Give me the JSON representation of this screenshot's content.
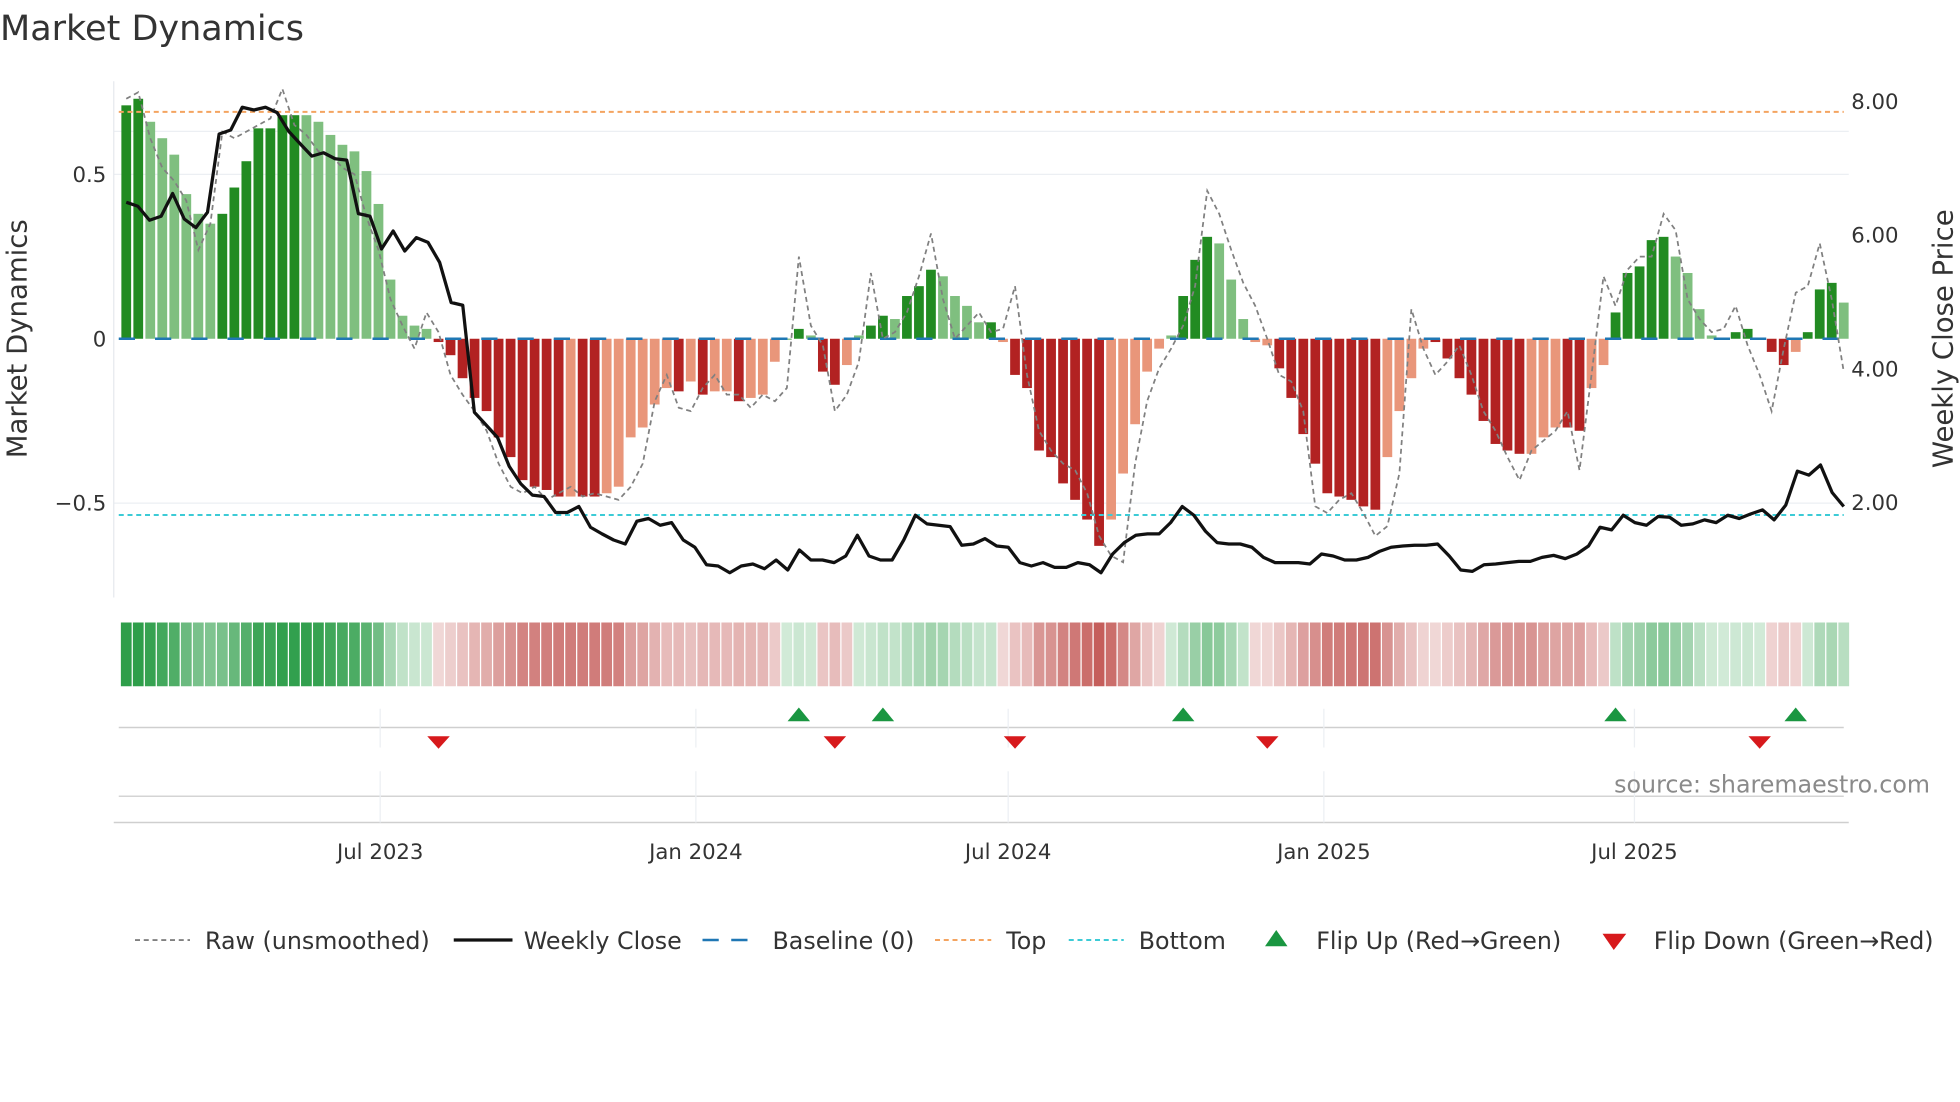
{
  "chart_data": {
    "type": "bar",
    "title": "Market Dynamics",
    "ylabel": "Market Dynamics",
    "ylabel_right": "Weekly Close Price",
    "ylim": [
      -0.78,
      0.78
    ],
    "ylim_right": [
      0.5,
      8.5
    ],
    "yticks": [
      {
        "value": 0.5,
        "label": "0.5"
      },
      {
        "value": 0,
        "label": "0"
      },
      {
        "value": -0.5,
        "label": "−0.5"
      }
    ],
    "yticks_right": [
      {
        "value": 8,
        "label": "8.00"
      },
      {
        "value": 6,
        "label": "6.00"
      },
      {
        "value": 4,
        "label": "4.00"
      },
      {
        "value": 2,
        "label": "2.00"
      }
    ],
    "xticks": [
      {
        "date": "2023-07-01",
        "label": "Jul 2023"
      },
      {
        "date": "2024-01-01",
        "label": "Jan 2024"
      },
      {
        "date": "2024-07-01",
        "label": "Jul 2024"
      },
      {
        "date": "2025-01-01",
        "label": "Jan 2025"
      },
      {
        "date": "2025-07-01",
        "label": "Jul 2025"
      }
    ],
    "x_start": "2023-02-03",
    "frequency": "weekly",
    "top_level": 0.69,
    "bottom_level": -0.536,
    "baseline": 0,
    "values": [
      0.71,
      0.73,
      0.66,
      0.61,
      0.56,
      0.44,
      0.38,
      0.35,
      0.38,
      0.46,
      0.54,
      0.64,
      0.64,
      0.68,
      0.68,
      0.68,
      0.66,
      0.62,
      0.59,
      0.57,
      0.51,
      0.41,
      0.18,
      0.07,
      0.04,
      0.03,
      -0.01,
      -0.05,
      -0.12,
      -0.18,
      -0.22,
      -0.3,
      -0.36,
      -0.43,
      -0.45,
      -0.46,
      -0.48,
      -0.48,
      -0.48,
      -0.48,
      -0.47,
      -0.45,
      -0.3,
      -0.27,
      -0.2,
      -0.15,
      -0.16,
      -0.13,
      -0.17,
      -0.16,
      -0.16,
      -0.19,
      -0.18,
      -0.17,
      -0.07,
      0.0,
      0.03,
      0.01,
      -0.1,
      -0.14,
      -0.08,
      0.01,
      0.04,
      0.07,
      0.06,
      0.13,
      0.16,
      0.21,
      0.19,
      0.13,
      0.1,
      0.05,
      0.05,
      -0.01,
      -0.11,
      -0.15,
      -0.34,
      -0.36,
      -0.44,
      -0.49,
      -0.55,
      -0.63,
      -0.55,
      -0.41,
      -0.26,
      -0.1,
      -0.03,
      0.01,
      0.13,
      0.24,
      0.31,
      0.29,
      0.18,
      0.06,
      -0.01,
      -0.02,
      -0.09,
      -0.18,
      -0.29,
      -0.38,
      -0.47,
      -0.48,
      -0.49,
      -0.51,
      -0.52,
      -0.36,
      -0.22,
      -0.12,
      -0.03,
      -0.01,
      -0.06,
      -0.12,
      -0.17,
      -0.25,
      -0.32,
      -0.34,
      -0.35,
      -0.35,
      -0.3,
      -0.27,
      -0.27,
      -0.28,
      -0.15,
      -0.08,
      0.08,
      0.2,
      0.22,
      0.3,
      0.31,
      0.25,
      0.2,
      0.09,
      0.01,
      0.0,
      0.02,
      0.03,
      0.0,
      -0.04,
      -0.08,
      -0.04,
      0.02,
      0.15,
      0.17,
      0.11
    ],
    "strength": [
      "d",
      "d",
      "l",
      "l",
      "l",
      "l",
      "l",
      "l",
      "d",
      "d",
      "d",
      "d",
      "d",
      "d",
      "d",
      "l",
      "l",
      "l",
      "l",
      "l",
      "l",
      "l",
      "l",
      "l",
      "l",
      "l",
      "d",
      "d",
      "d",
      "d",
      "d",
      "d",
      "d",
      "d",
      "d",
      "d",
      "d",
      "l",
      "d",
      "d",
      "l",
      "l",
      "l",
      "l",
      "l",
      "l",
      "d",
      "l",
      "d",
      "l",
      "l",
      "d",
      "l",
      "l",
      "l",
      "d",
      "d",
      "l",
      "d",
      "d",
      "l",
      "l",
      "d",
      "d",
      "l",
      "d",
      "d",
      "d",
      "l",
      "l",
      "l",
      "l",
      "d",
      "l",
      "d",
      "d",
      "d",
      "d",
      "d",
      "d",
      "d",
      "d",
      "l",
      "l",
      "l",
      "l",
      "l",
      "l",
      "d",
      "d",
      "d",
      "l",
      "l",
      "l",
      "l",
      "l",
      "d",
      "d",
      "d",
      "d",
      "d",
      "d",
      "d",
      "d",
      "d",
      "l",
      "l",
      "l",
      "l",
      "d",
      "d",
      "d",
      "d",
      "d",
      "d",
      "d",
      "d",
      "l",
      "l",
      "l",
      "d",
      "d",
      "l",
      "l",
      "d",
      "d",
      "d",
      "d",
      "d",
      "l",
      "l",
      "l",
      "l",
      "l",
      "d",
      "d",
      "l",
      "d",
      "d",
      "l",
      "d",
      "d",
      "d",
      "l"
    ],
    "raw": [
      0.73,
      0.75,
      0.61,
      0.52,
      0.48,
      0.42,
      0.27,
      0.35,
      0.63,
      0.61,
      0.63,
      0.65,
      0.67,
      0.76,
      0.65,
      0.62,
      0.57,
      0.56,
      0.52,
      0.5,
      0.37,
      0.27,
      0.12,
      0.04,
      -0.03,
      0.08,
      0.02,
      -0.11,
      -0.17,
      -0.22,
      -0.28,
      -0.38,
      -0.45,
      -0.47,
      -0.45,
      -0.49,
      -0.47,
      -0.45,
      -0.48,
      -0.47,
      -0.48,
      -0.49,
      -0.45,
      -0.38,
      -0.19,
      -0.11,
      -0.21,
      -0.22,
      -0.15,
      -0.11,
      -0.17,
      -0.17,
      -0.21,
      -0.17,
      -0.19,
      -0.15,
      0.25,
      0.04,
      -0.02,
      -0.22,
      -0.17,
      -0.07,
      0.2,
      0.0,
      0.02,
      0.08,
      0.19,
      0.32,
      0.12,
      0.0,
      0.04,
      0.08,
      0.02,
      0.03,
      0.16,
      -0.11,
      -0.28,
      -0.34,
      -0.38,
      -0.4,
      -0.47,
      -0.6,
      -0.66,
      -0.68,
      -0.38,
      -0.19,
      -0.09,
      -0.03,
      0.04,
      0.16,
      0.45,
      0.38,
      0.27,
      0.17,
      0.1,
      0.0,
      -0.11,
      -0.13,
      -0.22,
      -0.51,
      -0.53,
      -0.49,
      -0.47,
      -0.53,
      -0.6,
      -0.57,
      -0.41,
      0.09,
      -0.03,
      -0.11,
      -0.07,
      -0.02,
      -0.11,
      -0.22,
      -0.28,
      -0.36,
      -0.43,
      -0.34,
      -0.31,
      -0.28,
      -0.22,
      -0.4,
      -0.11,
      0.19,
      0.1,
      0.21,
      0.25,
      0.25,
      0.38,
      0.33,
      0.12,
      0.06,
      0.02,
      0.03,
      0.1,
      -0.02,
      -0.11,
      -0.22,
      -0.03,
      0.14,
      0.16,
      0.29,
      0.12,
      -0.1
    ],
    "weekly_close": [
      6.49,
      6.43,
      6.22,
      6.28,
      6.62,
      6.24,
      6.11,
      6.34,
      7.51,
      7.57,
      7.91,
      7.87,
      7.91,
      7.83,
      7.55,
      7.36,
      7.18,
      7.23,
      7.14,
      7.12,
      6.32,
      6.28,
      5.79,
      6.06,
      5.76,
      5.96,
      5.89,
      5.59,
      4.99,
      4.95,
      3.35,
      3.16,
      2.97,
      2.54,
      2.28,
      2.11,
      2.09,
      1.85,
      1.85,
      1.94,
      1.63,
      1.53,
      1.44,
      1.38,
      1.72,
      1.76,
      1.66,
      1.7,
      1.44,
      1.33,
      1.07,
      1.05,
      0.95,
      1.05,
      1.08,
      1.01,
      1.14,
      0.99,
      1.29,
      1.14,
      1.14,
      1.1,
      1.2,
      1.51,
      1.2,
      1.14,
      1.14,
      1.44,
      1.81,
      1.68,
      1.66,
      1.64,
      1.36,
      1.38,
      1.46,
      1.35,
      1.33,
      1.1,
      1.05,
      1.1,
      1.03,
      1.03,
      1.1,
      1.07,
      0.95,
      1.23,
      1.4,
      1.51,
      1.53,
      1.53,
      1.7,
      1.94,
      1.81,
      1.57,
      1.4,
      1.38,
      1.38,
      1.33,
      1.18,
      1.1,
      1.1,
      1.1,
      1.08,
      1.23,
      1.2,
      1.14,
      1.14,
      1.18,
      1.27,
      1.33,
      1.35,
      1.36,
      1.36,
      1.38,
      1.2,
      0.99,
      0.97,
      1.07,
      1.08,
      1.1,
      1.12,
      1.12,
      1.18,
      1.21,
      1.16,
      1.23,
      1.35,
      1.63,
      1.59,
      1.81,
      1.7,
      1.66,
      1.79,
      1.78,
      1.66,
      1.68,
      1.74,
      1.7,
      1.81,
      1.76,
      1.83,
      1.89,
      1.74,
      1.96,
      2.47,
      2.41,
      2.56,
      2.15,
      1.94
    ],
    "flip_up": [
      "2024-03-01",
      "2024-04-19",
      "2024-10-11",
      "2025-06-20",
      "2025-10-03"
    ],
    "flip_down": [
      "2023-08-04",
      "2024-03-22",
      "2024-07-05",
      "2024-11-29",
      "2025-09-12"
    ],
    "colors": {
      "green_strong": "#228b22",
      "green_weak": "#7fbf7f",
      "red_strong": "#b22222",
      "red_weak": "#e9967a",
      "heat_green": "#2e9e4a",
      "heat_red": "#c0504d",
      "top": "#f4a460",
      "bottom": "#3ccbd6",
      "baseline": "#1f77b4",
      "flip_up": "#1a9641",
      "flip_down": "#d7191c"
    },
    "legend": {
      "raw": "Raw (unsmoothed)",
      "close": "Weekly Close",
      "baseline": "Baseline (0)",
      "top": "Top",
      "bottom": "Bottom",
      "flip_up": "Flip Up (Red→Green)",
      "flip_down": "Flip Down (Green→Red)"
    },
    "source": "source: sharemaestro.com"
  }
}
